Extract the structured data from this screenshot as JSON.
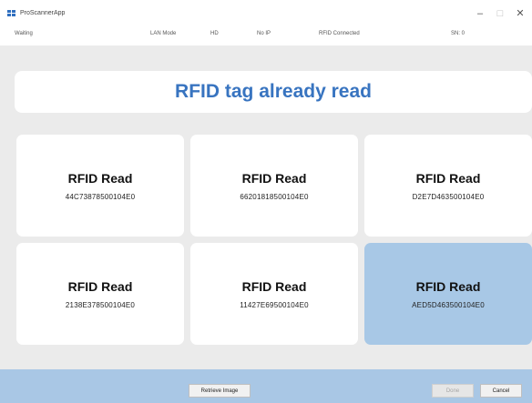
{
  "window": {
    "title": "ProScannerApp",
    "minimize_glyph": "–",
    "maximize_glyph": "□",
    "close_glyph": "✕"
  },
  "status": {
    "state": "Waiting",
    "mode": "LAN Mode",
    "hd": "HD",
    "ip": "No IP",
    "rfid": "RFID Connected",
    "sn": "SN: 0"
  },
  "banner": {
    "message": "RFID tag already read"
  },
  "cards": [
    {
      "title": "RFID Read",
      "id": "44C73878500104E0",
      "selected": false
    },
    {
      "title": "RFID Read",
      "id": "66201818500104E0",
      "selected": false
    },
    {
      "title": "RFID Read",
      "id": "D2E7D463500104E0",
      "selected": false
    },
    {
      "title": "RFID Read",
      "id": "2138E378500104E0",
      "selected": false
    },
    {
      "title": "RFID Read",
      "id": "11427E69500104E0",
      "selected": false
    },
    {
      "title": "RFID Read",
      "id": "AED5D463500104E0",
      "selected": true
    }
  ],
  "footer": {
    "retrieve_label": "Retrieve Image",
    "done_label": "Done",
    "cancel_label": "Cancel"
  },
  "colors": {
    "accent": "#3874c0",
    "selected_card": "#a8c8e6",
    "footer_bg": "#a9c7e5",
    "content_bg": "#ebebeb"
  }
}
